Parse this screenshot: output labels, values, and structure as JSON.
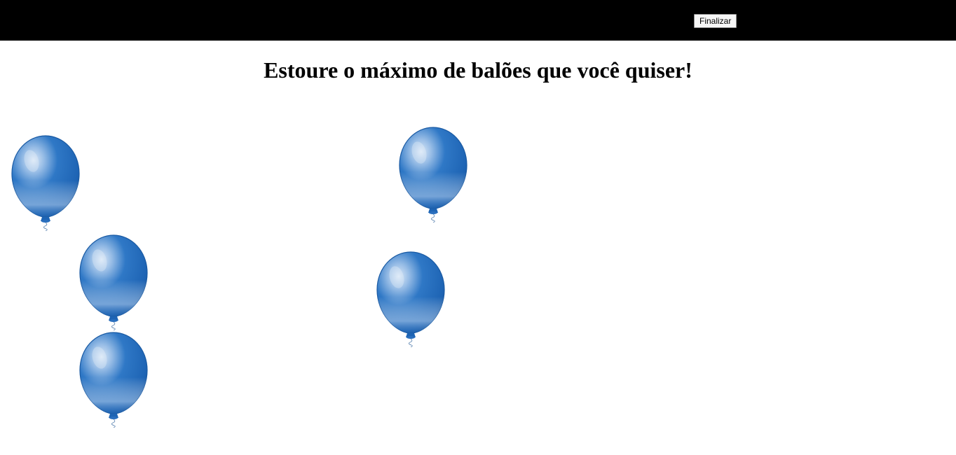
{
  "toolbar": {
    "finish_label": "Finalizar"
  },
  "game": {
    "title": "Estoure o máximo de balões que você quiser!",
    "balloons": [
      {
        "id": "1",
        "icon": "balloon-icon",
        "color": "#1e64b4"
      },
      {
        "id": "2",
        "icon": "balloon-icon",
        "color": "#1e64b4"
      },
      {
        "id": "3",
        "icon": "balloon-icon",
        "color": "#1e64b4"
      },
      {
        "id": "4",
        "icon": "balloon-icon",
        "color": "#1e64b4"
      },
      {
        "id": "5",
        "icon": "balloon-icon",
        "color": "#1e64b4"
      }
    ]
  },
  "colors": {
    "topbar": "#000000",
    "background": "#ffffff",
    "balloon": "#1e64b4"
  }
}
